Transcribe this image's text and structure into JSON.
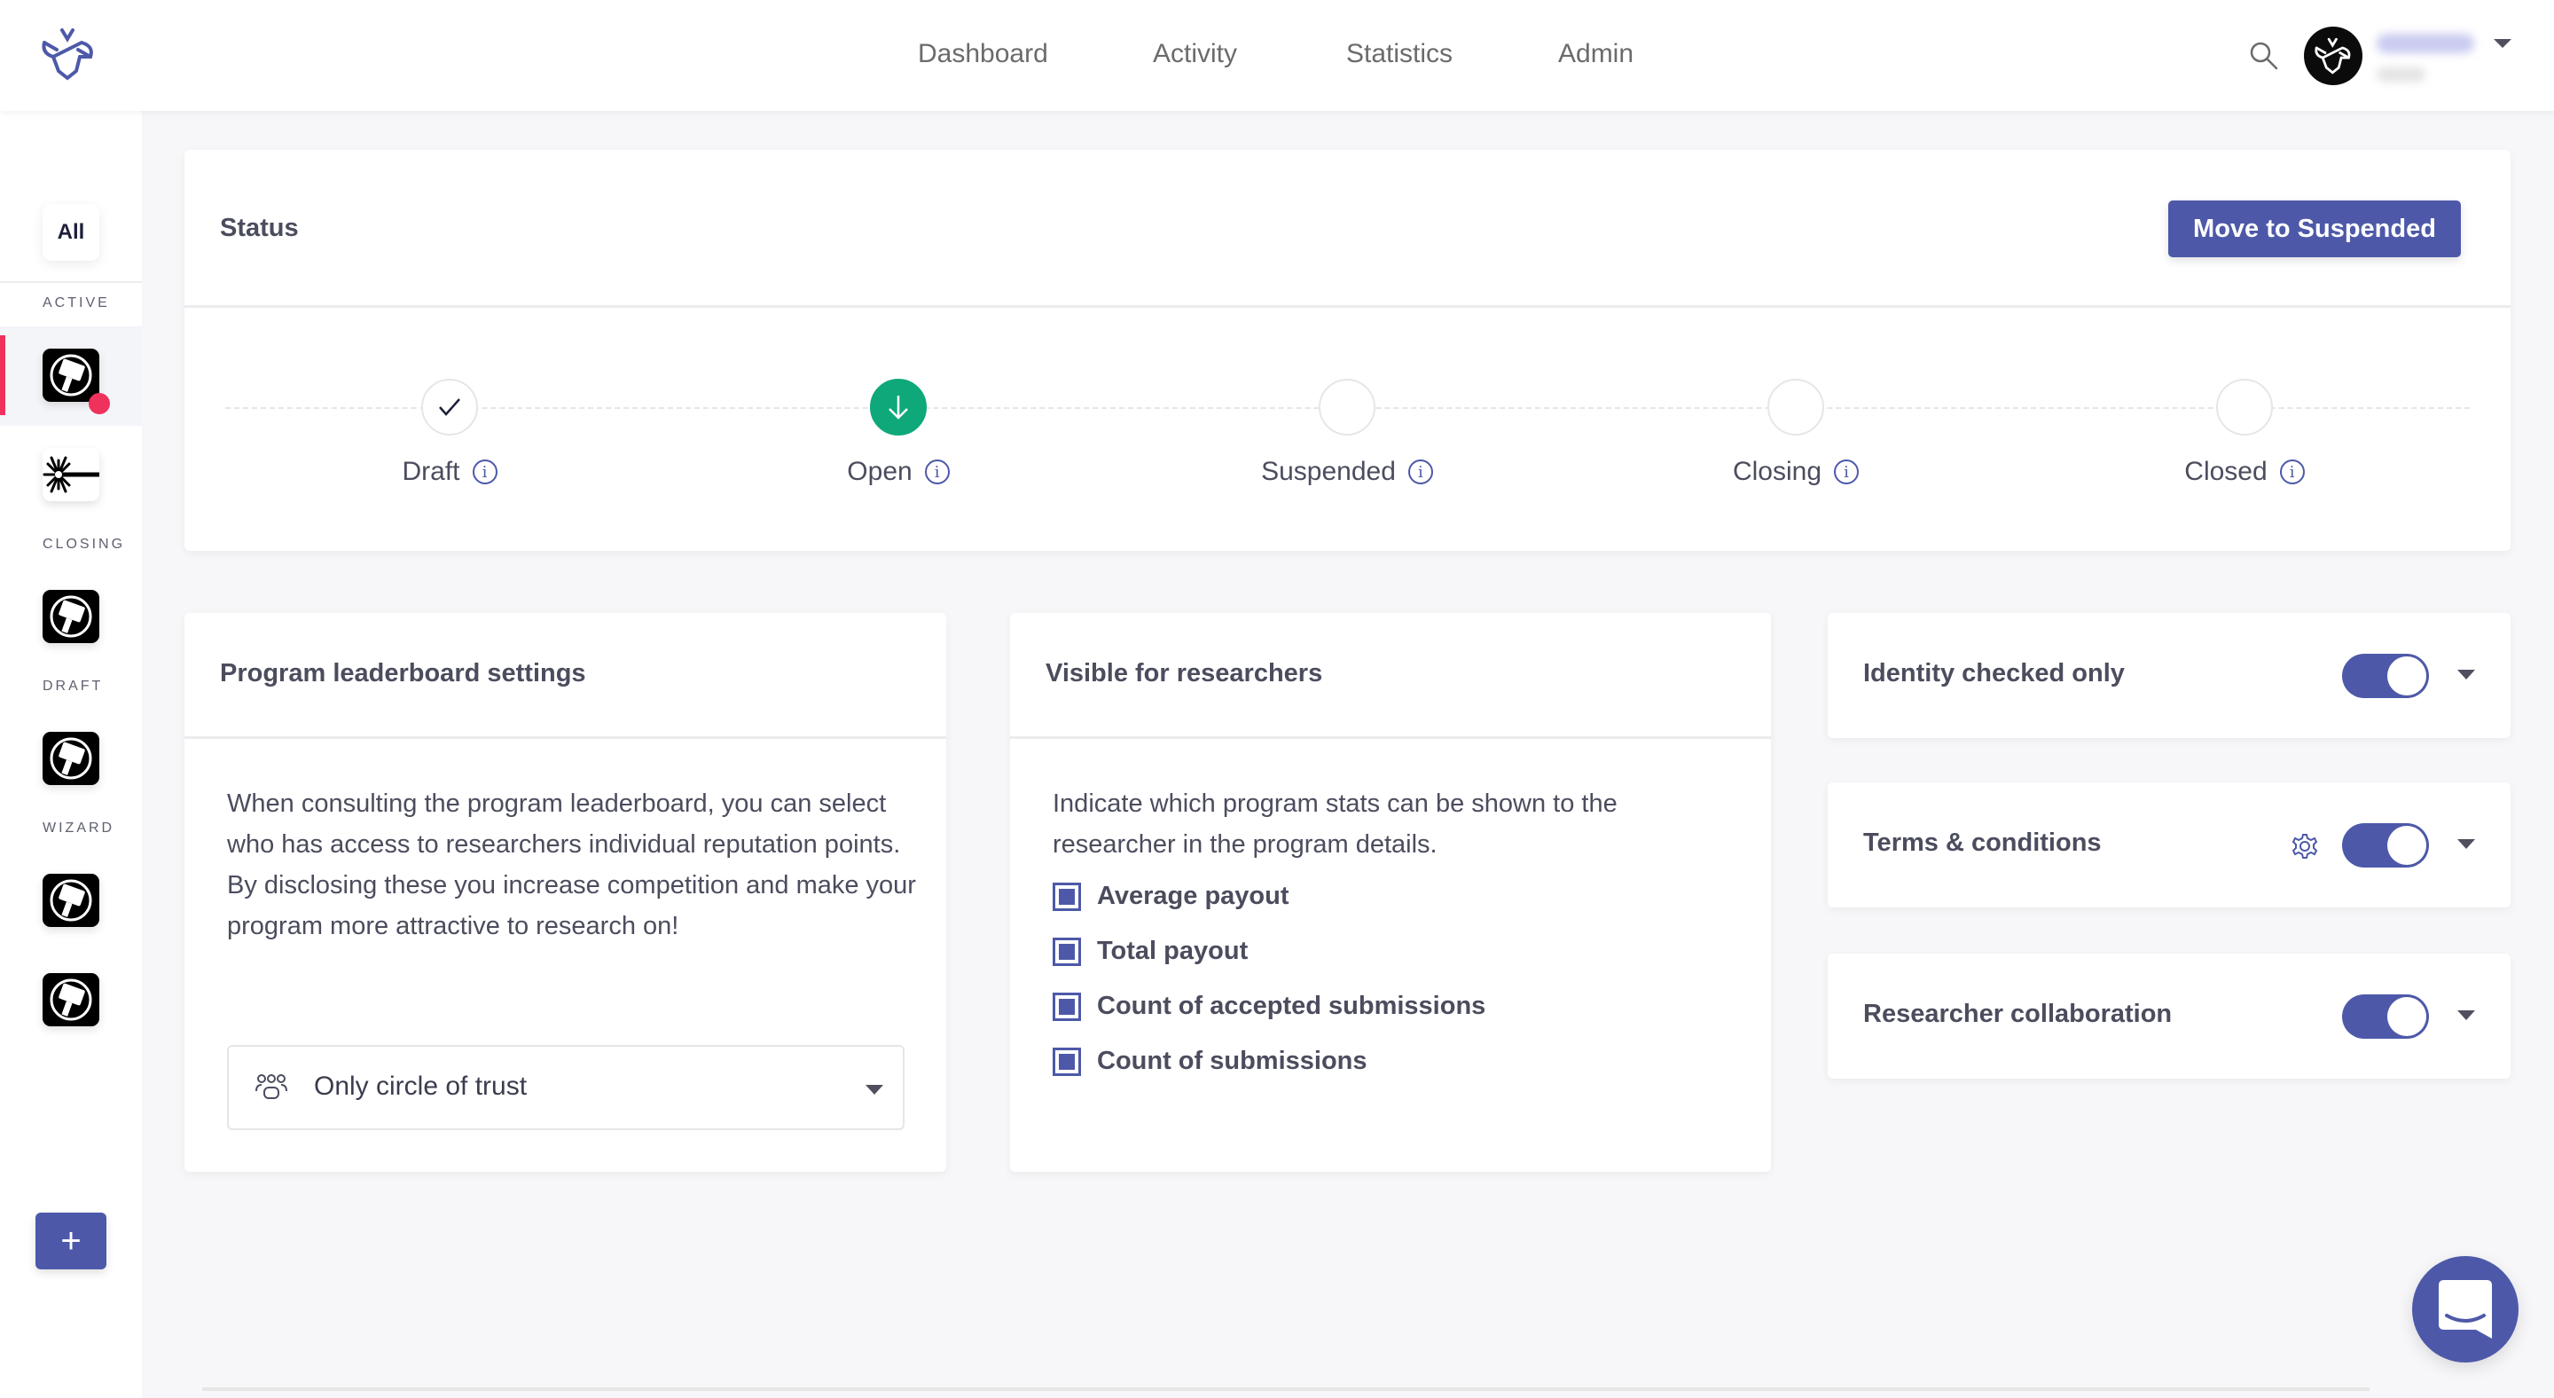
{
  "header": {
    "nav": [
      {
        "label": "Dashboard"
      },
      {
        "label": "Activity"
      },
      {
        "label": "Statistics"
      },
      {
        "label": "Admin"
      }
    ],
    "user": {
      "name": "(blurred)",
      "role": "(blurred)"
    }
  },
  "sidebar": {
    "all_label": "All",
    "groups": [
      {
        "label": "ACTIVE"
      },
      {
        "label": "CLOSING"
      },
      {
        "label": "DRAFT"
      },
      {
        "label": "WIZARD"
      }
    ],
    "add_label": "+"
  },
  "status": {
    "title": "Status",
    "action_label": "Move to Suspended",
    "steps": [
      {
        "label": "Draft",
        "state": "done"
      },
      {
        "label": "Open",
        "state": "current"
      },
      {
        "label": "Suspended",
        "state": "pending"
      },
      {
        "label": "Closing",
        "state": "pending"
      },
      {
        "label": "Closed",
        "state": "pending"
      }
    ],
    "info_glyph": "i"
  },
  "leaderboard": {
    "title": "Program leaderboard settings",
    "description": "When consulting the program leaderboard, you can select who has access to researchers individual reputation points. By disclosing these you increase competition and make your program more attractive to research on!",
    "select_value": "Only circle of trust"
  },
  "visibility": {
    "title": "Visible for researchers",
    "description": "Indicate which program stats can be shown to the researcher in the program details.",
    "options": [
      {
        "label": "Average payout",
        "checked": true
      },
      {
        "label": "Total payout",
        "checked": true
      },
      {
        "label": "Count of accepted submissions",
        "checked": true
      },
      {
        "label": "Count of submissions",
        "checked": true
      }
    ]
  },
  "toggles": [
    {
      "label": "Identity checked only",
      "enabled": true
    },
    {
      "label": "Terms & conditions",
      "enabled": true
    },
    {
      "label": "Researcher collaboration",
      "enabled": true
    }
  ],
  "colors": {
    "primary": "#4d59a8",
    "success": "#0fa87a",
    "alert": "#ef325b",
    "text": "#4b4d5e"
  }
}
